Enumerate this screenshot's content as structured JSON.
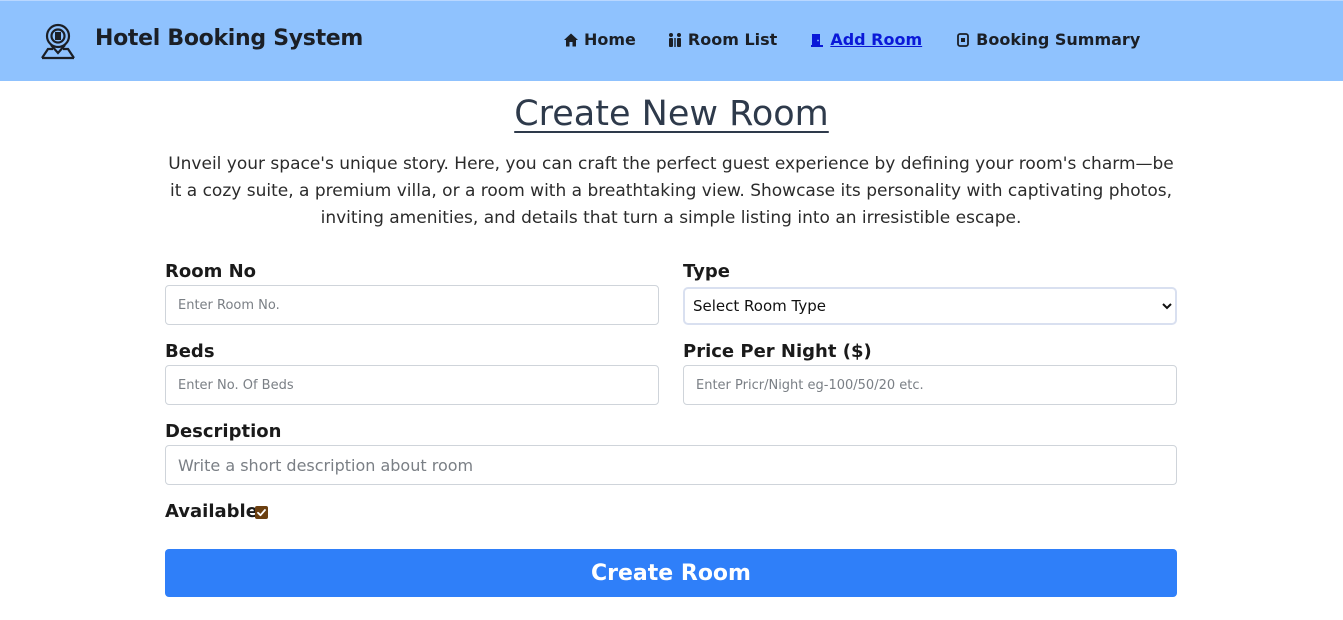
{
  "navbar": {
    "brand_title": "Hotel Booking System",
    "brand_icon": "hotel-location-icon",
    "links": [
      {
        "label": "Home",
        "icon": "home-icon"
      },
      {
        "label": "Room List",
        "icon": "people-icon"
      },
      {
        "label": "Add Room",
        "icon": "door-icon",
        "active": true
      },
      {
        "label": "Booking Summary",
        "icon": "booking-icon"
      }
    ],
    "colors": {
      "background": "#8fc2fe",
      "active_link": "#0a18d8"
    }
  },
  "main": {
    "title": "Create New Room",
    "intro": "Unveil your space's unique story. Here, you can craft the perfect guest experience by defining your room's charm—be it a cozy suite, a premium villa, or a room with a breathtaking view. Showcase its personality with captivating photos, inviting amenities, and details that turn a simple listing into an irresistible escape."
  },
  "form": {
    "room_no": {
      "label": "Room No",
      "placeholder": "Enter Room No.",
      "value": ""
    },
    "type": {
      "label": "Type",
      "selected": "Select Room Type"
    },
    "beds": {
      "label": "Beds",
      "placeholder": "Enter No. Of Beds",
      "value": ""
    },
    "price": {
      "label": "Price Per Night ($)",
      "placeholder": "Enter Pricr/Night eg-100/50/20 etc.",
      "value": ""
    },
    "description": {
      "label": "Description",
      "placeholder": "Write a short description about room",
      "value": ""
    },
    "available": {
      "label": "Available",
      "checked": true
    },
    "submit_label": "Create Room",
    "colors": {
      "submit": "#2f7ff9",
      "checkbox": "#6b3f10"
    }
  }
}
